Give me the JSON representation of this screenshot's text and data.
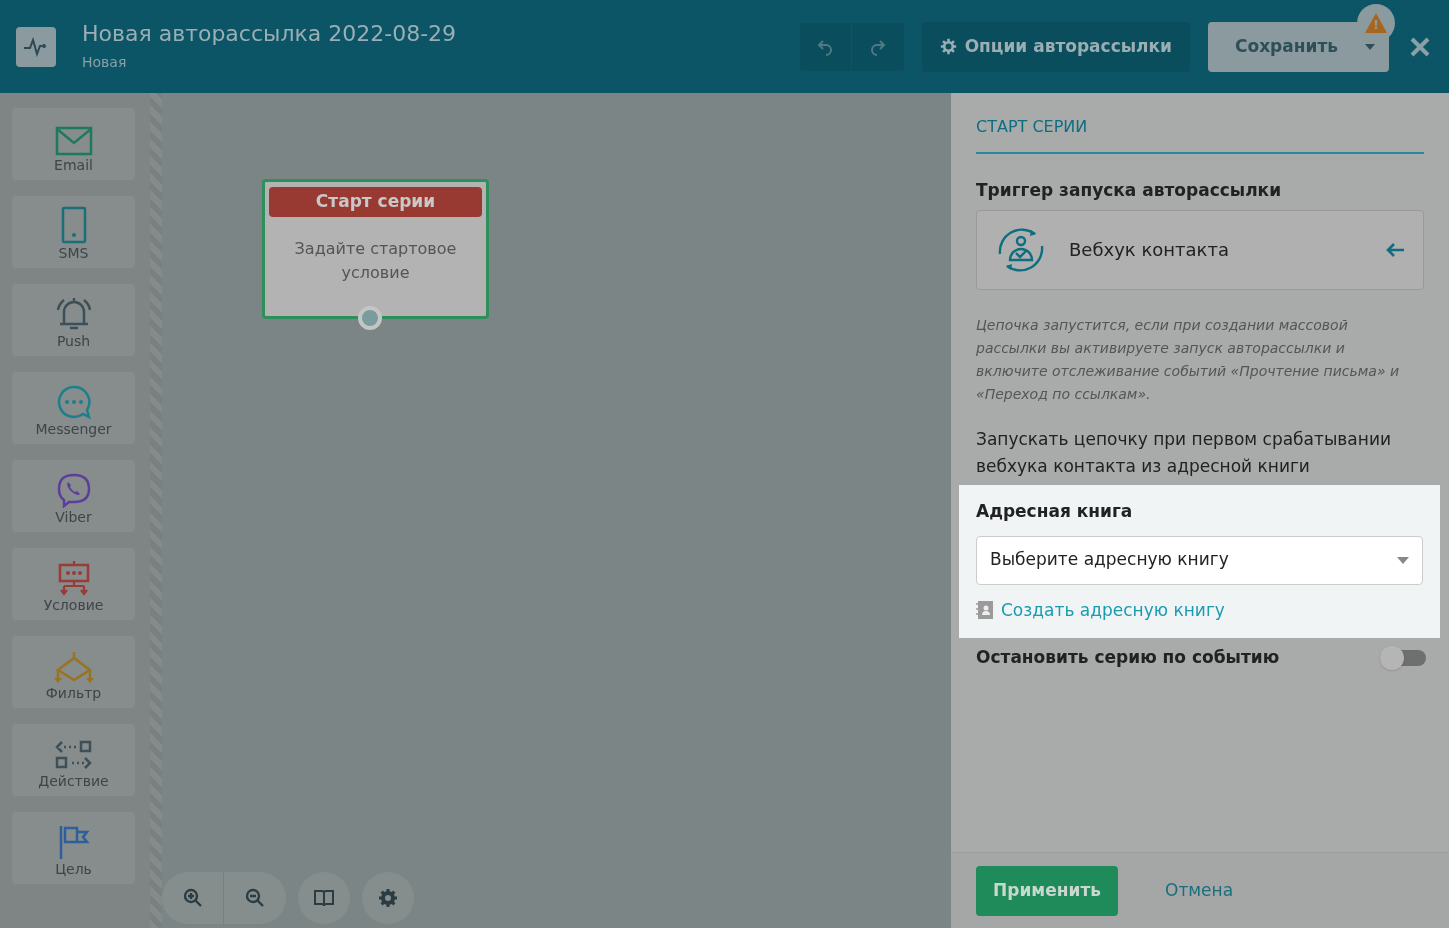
{
  "header": {
    "title": "Новая авторассылка 2022-08-29",
    "subtitle": "Новая",
    "options_button": "Опции авторассылки",
    "save_button": "Сохранить",
    "warning": "!"
  },
  "palette": [
    {
      "kind": "email",
      "label": "Email",
      "color": "#1f7a5c"
    },
    {
      "kind": "sms",
      "label": "SMS",
      "color": "#1a6f7a"
    },
    {
      "kind": "push",
      "label": "Push",
      "color": "#3d4f57"
    },
    {
      "kind": "messenger",
      "label": "Messenger",
      "color": "#1b7f8c"
    },
    {
      "kind": "viber",
      "label": "Viber",
      "color": "#5b3f9a"
    },
    {
      "kind": "condition",
      "label": "Условие",
      "color": "#9a3b35"
    },
    {
      "kind": "filter",
      "label": "Фильтр",
      "color": "#9a7320"
    },
    {
      "kind": "action",
      "label": "Действие",
      "color": "#3d4f57"
    },
    {
      "kind": "goal",
      "label": "Цель",
      "color": "#2f5f9a"
    }
  ],
  "node": {
    "title": "Старт серии",
    "text": "Задайте стартовое условие"
  },
  "panel": {
    "section_title": "СТАРТ СЕРИИ",
    "trigger_label": "Триггер запуска авторассылки",
    "trigger_value": "Вебхук контакта",
    "description": "Цепочка запустится, если при создании массовой рассылки вы активируете запуск авторассылки и включите отслеживание событий «Прочтение письма» и «Переход по ссылкам».",
    "note": "Запускать цепочку при первом срабатывании вебхука контакта из адресной книги",
    "address_book": {
      "label": "Адресная книга",
      "placeholder": "Выберите адресную книгу",
      "create_link": "Создать адресную книгу"
    },
    "stop_toggle": {
      "label": "Остановить серию по событию",
      "on": false
    },
    "apply_button": "Применить",
    "cancel_button": "Отмена"
  }
}
